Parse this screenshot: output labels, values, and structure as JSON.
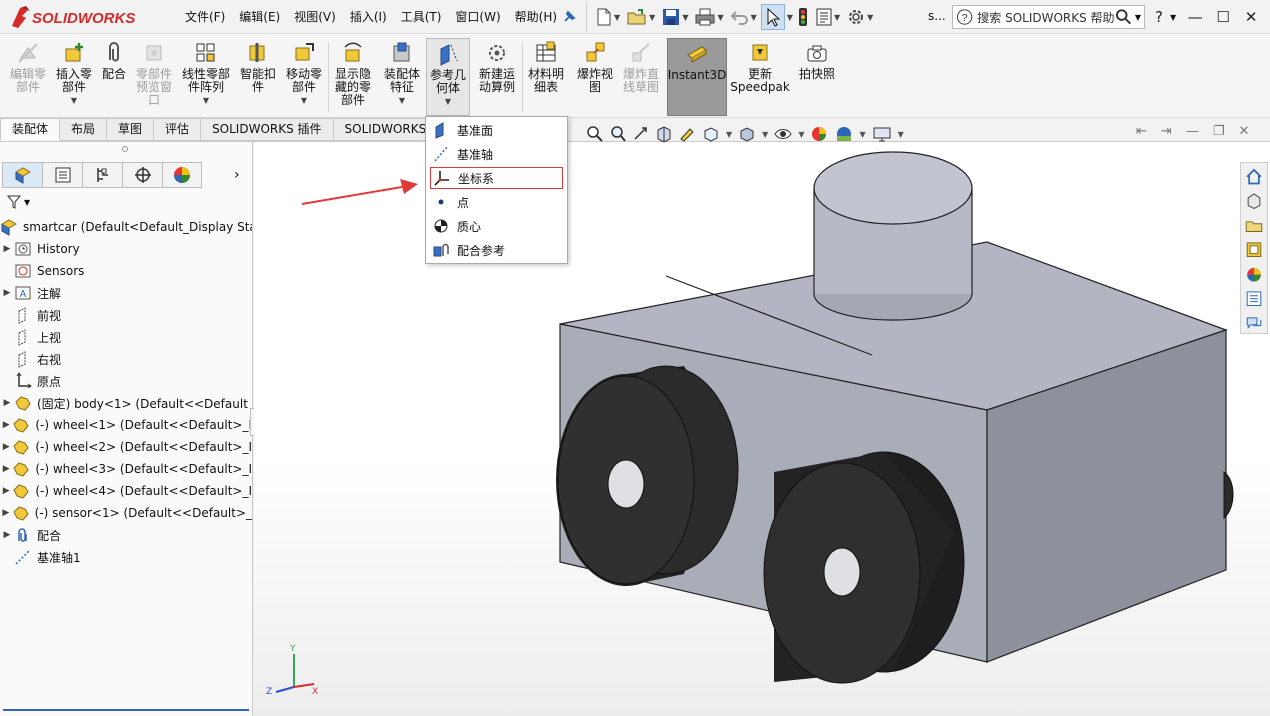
{
  "app": {
    "logo_text": "SOLIDWORKS",
    "title_short": "s..."
  },
  "menu": [
    "文件(F)",
    "编辑(E)",
    "视图(V)",
    "插入(I)",
    "工具(T)",
    "窗口(W)",
    "帮助(H)"
  ],
  "search": {
    "placeholder": "搜索 SOLIDWORKS 帮助"
  },
  "ribbon": {
    "edit_component": "编辑零\n部件",
    "insert_component": "插入零\n部件",
    "mate": "配合",
    "component_preview": "零部件\n预览窗\n口",
    "linear_pattern": "线性零部\n件阵列",
    "smart_fasteners": "智能扣\n件",
    "move_component": "移动零\n部件",
    "show_hidden": "显示隐\n藏的零\n部件",
    "assembly_features": "装配体\n特征",
    "reference_geometry": "参考几\n何体",
    "new_motion_study": "新建运\n动算例",
    "bill_of_materials": "材料明\n细表",
    "exploded_view": "爆炸视\n图",
    "explode_line": "爆炸直\n线草图",
    "instant3d": "Instant3D",
    "update_speedpak": "更新\nSpeedpak",
    "take_snapshot": "拍快照"
  },
  "tabs": [
    "装配体",
    "布局",
    "草图",
    "评估",
    "SOLIDWORKS 插件",
    "SOLIDWORKS"
  ],
  "tree": {
    "root": "smartcar  (Default<Default_Display Sta",
    "items": [
      {
        "label": "History",
        "icon": "history-icon",
        "expand": true
      },
      {
        "label": "Sensors",
        "icon": "sensors-icon",
        "expand": false
      },
      {
        "label": "注解",
        "icon": "annotations-icon",
        "expand": true
      },
      {
        "label": "前视",
        "icon": "plane-icon",
        "expand": false
      },
      {
        "label": "上视",
        "icon": "plane-icon",
        "expand": false
      },
      {
        "label": "右视",
        "icon": "plane-icon",
        "expand": false
      },
      {
        "label": "原点",
        "icon": "origin-icon",
        "expand": false
      },
      {
        "label": "(固定) body<1> (Default<<Default",
        "icon": "part-icon",
        "expand": true
      },
      {
        "label": "(-) wheel<1> (Default<<Default>_I",
        "icon": "part-icon",
        "expand": true
      },
      {
        "label": "(-) wheel<2> (Default<<Default>_I",
        "icon": "part-icon",
        "expand": true
      },
      {
        "label": "(-) wheel<3> (Default<<Default>_I",
        "icon": "part-icon",
        "expand": true
      },
      {
        "label": "(-) wheel<4> (Default<<Default>_I",
        "icon": "part-icon",
        "expand": true
      },
      {
        "label": "(-) sensor<1> (Default<<Default>_",
        "icon": "part-icon",
        "expand": true
      },
      {
        "label": "配合",
        "icon": "mates-icon",
        "expand": true
      },
      {
        "label": "基准轴1",
        "icon": "axis-icon",
        "expand": false
      }
    ]
  },
  "dropdown": {
    "items": [
      {
        "label": "基准面",
        "icon": "plane-icon"
      },
      {
        "label": "基准轴",
        "icon": "axis-icon"
      },
      {
        "label": "坐标系",
        "icon": "coordinate-system-icon"
      },
      {
        "label": "点",
        "icon": "point-icon"
      },
      {
        "label": "质心",
        "icon": "center-of-mass-icon"
      },
      {
        "label": "配合参考",
        "icon": "mate-reference-icon"
      }
    ],
    "highlighted": "坐标系"
  },
  "triad": {
    "x": "X",
    "y": "Y",
    "z": "Z"
  },
  "colors": {
    "accent_red": "#d72a2a",
    "selection_blue": "#2f64c6",
    "model_gray": "#a9adb8",
    "wheel_black": "#2b2b2b"
  }
}
